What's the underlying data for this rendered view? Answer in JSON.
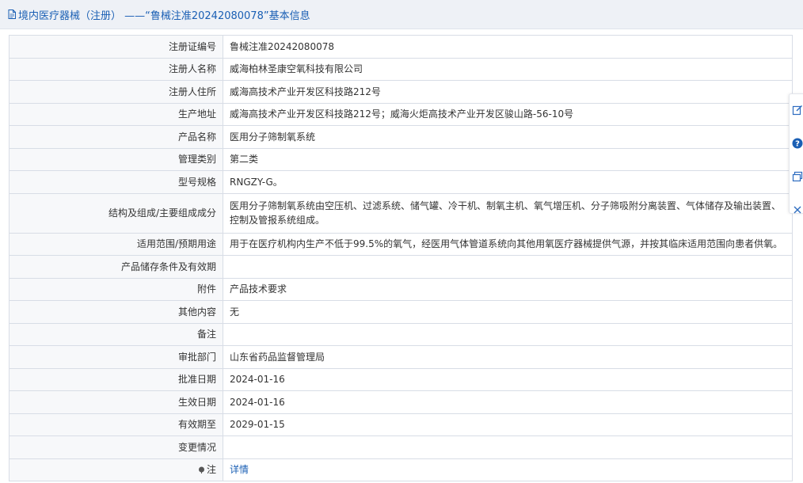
{
  "header": {
    "title": "境内医疗器械（注册） ——“鲁械注准20242080078”基本信息",
    "icon": "document-icon"
  },
  "table": {
    "rows": [
      {
        "label": "注册证编号",
        "value": "鲁械注准20242080078"
      },
      {
        "label": "注册人名称",
        "value": "威海柏林圣康空氧科技有限公司"
      },
      {
        "label": "注册人住所",
        "value": "威海高技术产业开发区科技路212号"
      },
      {
        "label": "生产地址",
        "value": "威海高技术产业开发区科技路212号；威海火炬高技术产业开发区骏山路-56-10号"
      },
      {
        "label": "产品名称",
        "value": "医用分子筛制氧系统"
      },
      {
        "label": "管理类别",
        "value": "第二类"
      },
      {
        "label": "型号规格",
        "value": "RNGZY-G。"
      },
      {
        "label": "结构及组成/主要组成成分",
        "value": "医用分子筛制氧系统由空压机、过滤系统、储气罐、冷干机、制氧主机、氧气增压机、分子筛吸附分离装置、气体储存及输出装置、控制及管报系统组成。"
      },
      {
        "label": "适用范围/预期用途",
        "value": "用于在医疗机构内生产不低于99.5%的氧气，经医用气体管道系统向其他用氧医疗器械提供气源，并按其临床适用范围向患者供氧。"
      },
      {
        "label": "产品储存条件及有效期",
        "value": ""
      },
      {
        "label": "附件",
        "value": "产品技术要求"
      },
      {
        "label": "其他内容",
        "value": "无"
      },
      {
        "label": "备注",
        "value": ""
      },
      {
        "label": "审批部门",
        "value": "山东省药品监督管理局"
      },
      {
        "label": "批准日期",
        "value": "2024-01-16"
      },
      {
        "label": "生效日期",
        "value": "2024-01-16"
      },
      {
        "label": "有效期至",
        "value": "2029-01-15"
      },
      {
        "label": "变更情况",
        "value": ""
      },
      {
        "label": "注",
        "value": "详情"
      }
    ]
  },
  "side_tools": [
    "edit-icon",
    "help-icon",
    "copy-icon",
    "close-icon"
  ],
  "colors": {
    "link": "#1a5fb4",
    "header_bg": "#eef1f6",
    "label_bg": "#f7f8fa",
    "border": "#d8dde6"
  }
}
